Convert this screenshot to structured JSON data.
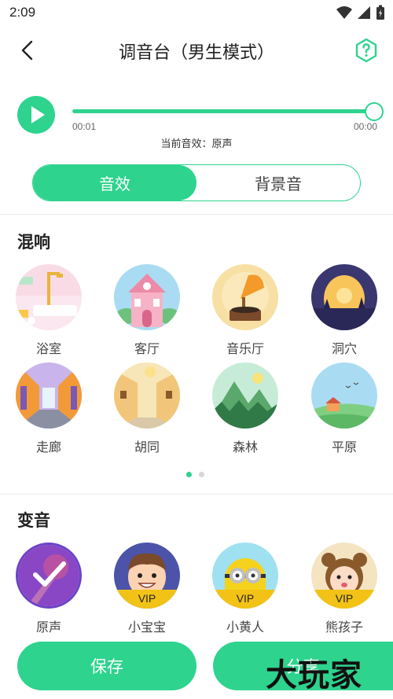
{
  "status_bar": {
    "time": "2:09"
  },
  "header": {
    "title": "调音台（男生模式）",
    "back_icon": "chevron-left-icon",
    "help_icon": "help-hexagon-icon"
  },
  "player": {
    "current_time": "00:01",
    "total_time": "00:00",
    "progress": 1.0,
    "current_effect": "当前音效：原声"
  },
  "tabs": [
    {
      "label": "音效",
      "active": true
    },
    {
      "label": "背景音",
      "active": false
    }
  ],
  "reverb": {
    "title": "混响",
    "items": [
      {
        "label": "浴室",
        "icon": "bathroom-icon"
      },
      {
        "label": "客厅",
        "icon": "living-room-icon"
      },
      {
        "label": "音乐厅",
        "icon": "gramophone-icon"
      },
      {
        "label": "洞穴",
        "icon": "cave-icon"
      },
      {
        "label": "走廊",
        "icon": "corridor-icon"
      },
      {
        "label": "胡同",
        "icon": "alley-icon"
      },
      {
        "label": "森林",
        "icon": "forest-icon"
      },
      {
        "label": "平原",
        "icon": "plain-icon"
      }
    ],
    "page_index": 0,
    "page_count": 2
  },
  "voice_change": {
    "title": "变音",
    "items": [
      {
        "label": "原声",
        "badge": "",
        "selected": true
      },
      {
        "label": "小宝宝",
        "badge": "VIP"
      },
      {
        "label": "小黄人",
        "badge": "VIP"
      },
      {
        "label": "熊孩子",
        "badge": "VIP"
      }
    ]
  },
  "actions": {
    "save_label": "保存",
    "share_label": "分享"
  },
  "watermark": "大玩家",
  "colors": {
    "accent": "#2ed38e",
    "vip": "#f2c316"
  }
}
